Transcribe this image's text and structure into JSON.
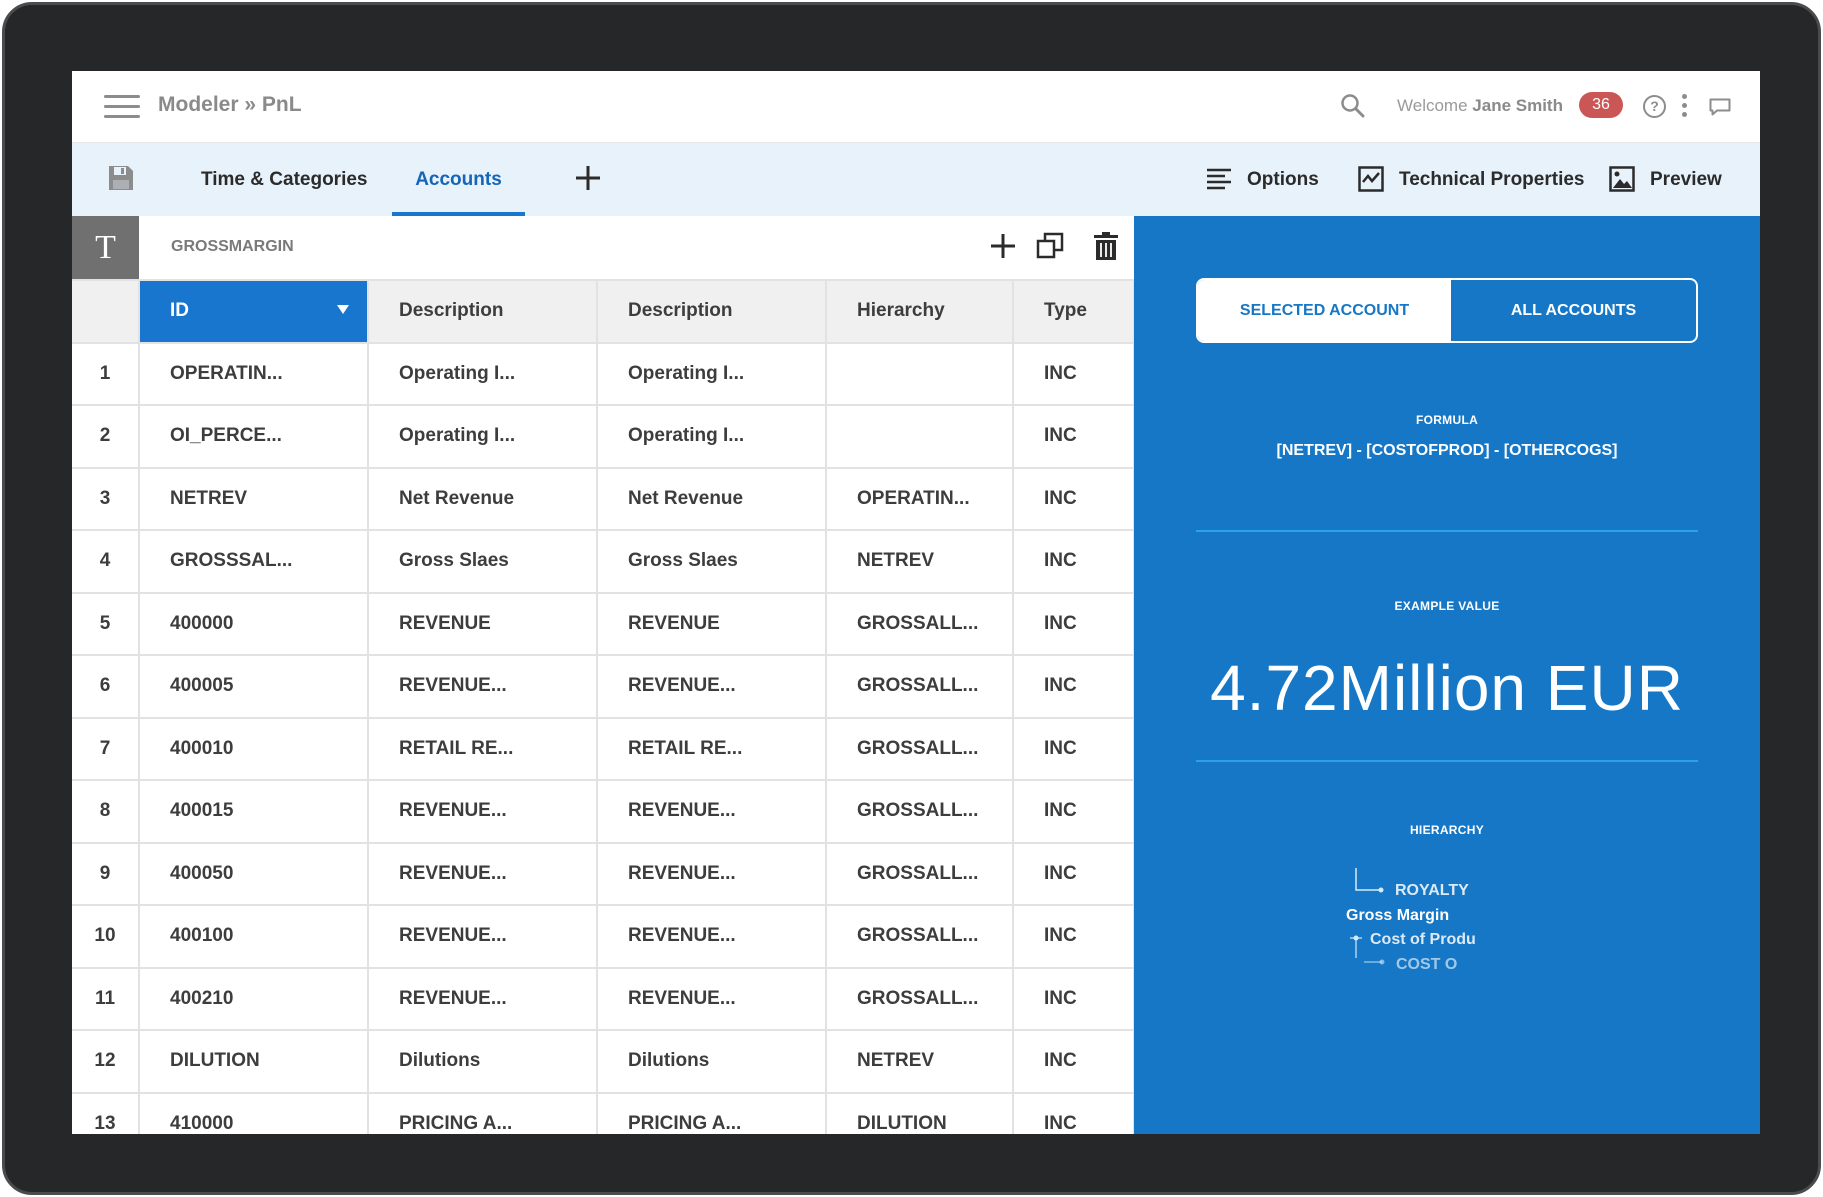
{
  "header": {
    "breadcrumb": "Modeler » PnL",
    "welcome_prefix": "Welcome",
    "user_name": "Jane Smith",
    "notification_count": "36",
    "help_symbol": "?"
  },
  "toolbar": {
    "tabs": [
      {
        "label": "Time & Categories",
        "active": false
      },
      {
        "label": "Accounts",
        "active": true
      }
    ],
    "options_label": "Options",
    "technical_label": "Technical Properties",
    "preview_label": "Preview"
  },
  "sheet": {
    "type_badge": "T",
    "title": "GROSSMARGIN",
    "columns": [
      "ID",
      "Description",
      "Description",
      "Hierarchy",
      "Type"
    ],
    "rows": [
      [
        "1",
        "OPERATIN...",
        "Operating I...",
        "Operating I...",
        "",
        "INC"
      ],
      [
        "2",
        "OI_PERCE...",
        "Operating I...",
        "Operating I...",
        "",
        "INC"
      ],
      [
        "3",
        "NETREV",
        "Net Revenue",
        "Net Revenue",
        "OPERATIN...",
        "INC"
      ],
      [
        "4",
        "GROSSSAL...",
        "Gross Slaes",
        "Gross Slaes",
        "NETREV",
        "INC"
      ],
      [
        "5",
        "400000",
        "REVENUE",
        "REVENUE",
        "GROSSALL...",
        "INC"
      ],
      [
        "6",
        "400005",
        "REVENUE...",
        "REVENUE...",
        "GROSSALL...",
        "INC"
      ],
      [
        "7",
        "400010",
        "RETAIL RE...",
        "RETAIL RE...",
        "GROSSALL...",
        "INC"
      ],
      [
        "8",
        "400015",
        "REVENUE...",
        "REVENUE...",
        "GROSSALL...",
        "INC"
      ],
      [
        "9",
        "400050",
        "REVENUE...",
        "REVENUE...",
        "GROSSALL...",
        "INC"
      ],
      [
        "10",
        "400100",
        "REVENUE...",
        "REVENUE...",
        "GROSSALL...",
        "INC"
      ],
      [
        "11",
        "400210",
        "REVENUE...",
        "REVENUE...",
        "GROSSALL...",
        "INC"
      ],
      [
        "12",
        "DILUTION",
        "Dilutions",
        "Dilutions",
        "NETREV",
        "INC"
      ],
      [
        "13",
        "410000",
        "PRICING A...",
        "PRICING A...",
        "DILUTION",
        "INC"
      ]
    ]
  },
  "panel": {
    "selected_account_label": "SELECTED ACCOUNT",
    "all_accounts_label": "ALL ACCOUNTS",
    "formula_label": "FORMULA",
    "formula": "[NETREV]  -  [COSTOFPROD]  -  [OTHERCOGS]",
    "example_label": "EXAMPLE VALUE",
    "example_value": "4.72Million EUR",
    "hierarchy_label": "HIERARCHY",
    "hierarchy_nodes": [
      "ROYALTY",
      "Gross Margin",
      "Cost of Produ",
      "COST O"
    ]
  },
  "colors": {
    "accent": "#1976cf",
    "panel_bg": "#1577c6",
    "badge": "#cb5656",
    "toolbar_bg": "#e7f2fb"
  }
}
